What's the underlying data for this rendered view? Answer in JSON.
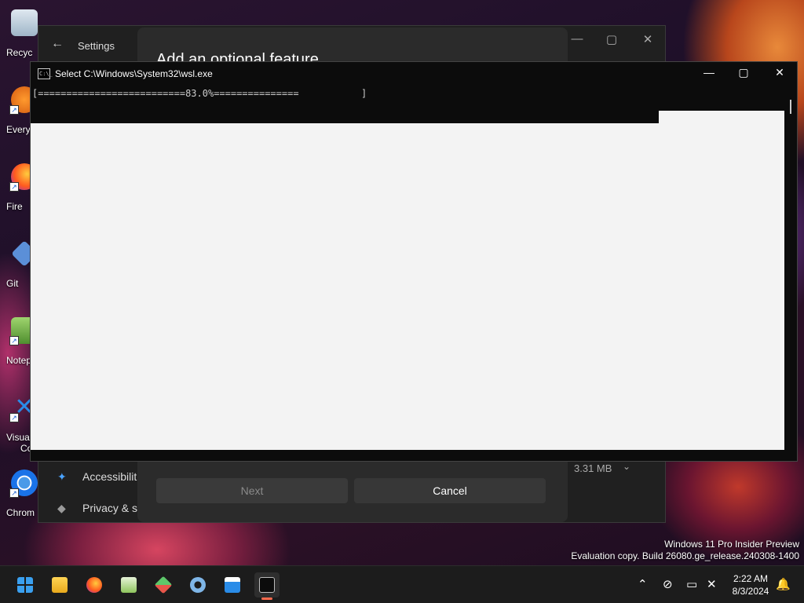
{
  "desktop": {
    "icons": [
      {
        "label": "Recyc",
        "icon": "recycle-bin-icon"
      },
      {
        "label": "Every",
        "icon": "everything-icon"
      },
      {
        "label": "Fire",
        "icon": "firefox-icon"
      },
      {
        "label": "Git",
        "icon": "git-icon"
      },
      {
        "label": "Notep",
        "icon": "notepad-icon"
      },
      {
        "label": "Visual",
        "label2": "Co",
        "icon": "vscode-icon"
      },
      {
        "label": "Chrom",
        "icon": "chrome-icon"
      }
    ]
  },
  "settings": {
    "app_title": "Settings",
    "dialog_title": "Add an optional feature",
    "nav": [
      {
        "label": "Accessibilit",
        "icon": "accessibility-icon"
      },
      {
        "label": "Privacy & s",
        "icon": "shield-icon"
      }
    ],
    "size_label": "3.31 MB",
    "buttons": {
      "next": "Next",
      "cancel": "Cancel"
    }
  },
  "console": {
    "title": "Select C:\\Windows\\System32\\wsl.exe",
    "progress_text": "[==========================83.0%===============           ]",
    "progress_percent": 83.0
  },
  "watermark": {
    "line1": "Windows 11 Pro Insider Preview",
    "line2": "Evaluation copy. Build 26080.ge_release.240308-1400"
  },
  "taskbar": {
    "apps": [
      "start-icon",
      "file-explorer-icon",
      "firefox-icon",
      "notepad-icon",
      "git-icon",
      "settings-icon",
      "sandbox-icon",
      "terminal-icon"
    ],
    "time": "2:22 AM",
    "date": "8/3/2024"
  },
  "colors": {
    "accent": "#ff6a4d",
    "console_bg": "#0c0c0c",
    "dialog_bg": "#2b2b2b"
  }
}
